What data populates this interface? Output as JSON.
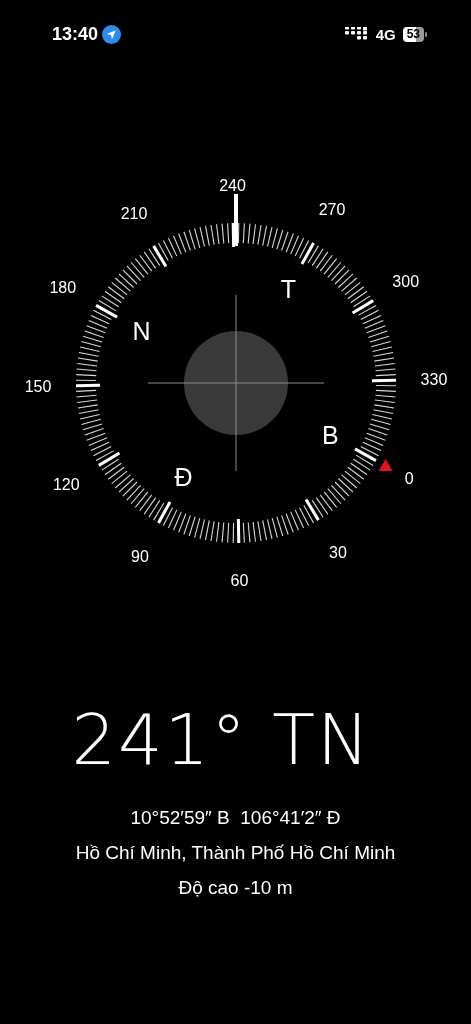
{
  "status_bar": {
    "time": "13:40",
    "network": "4G",
    "battery": "53"
  },
  "compass": {
    "dial_labels": [
      "0",
      "30",
      "60",
      "90",
      "120",
      "150",
      "180",
      "210",
      "240",
      "270",
      "300",
      "330"
    ],
    "cardinals": [
      "B",
      "Đ",
      "N",
      "T"
    ]
  },
  "heading": "241° TN",
  "coordinates": "10°52′59″ B  106°41′2″ Đ",
  "location": "Hồ Chí Minh, Thành Phố Hồ Chí Minh",
  "altitude": "Độ cao -10 m"
}
